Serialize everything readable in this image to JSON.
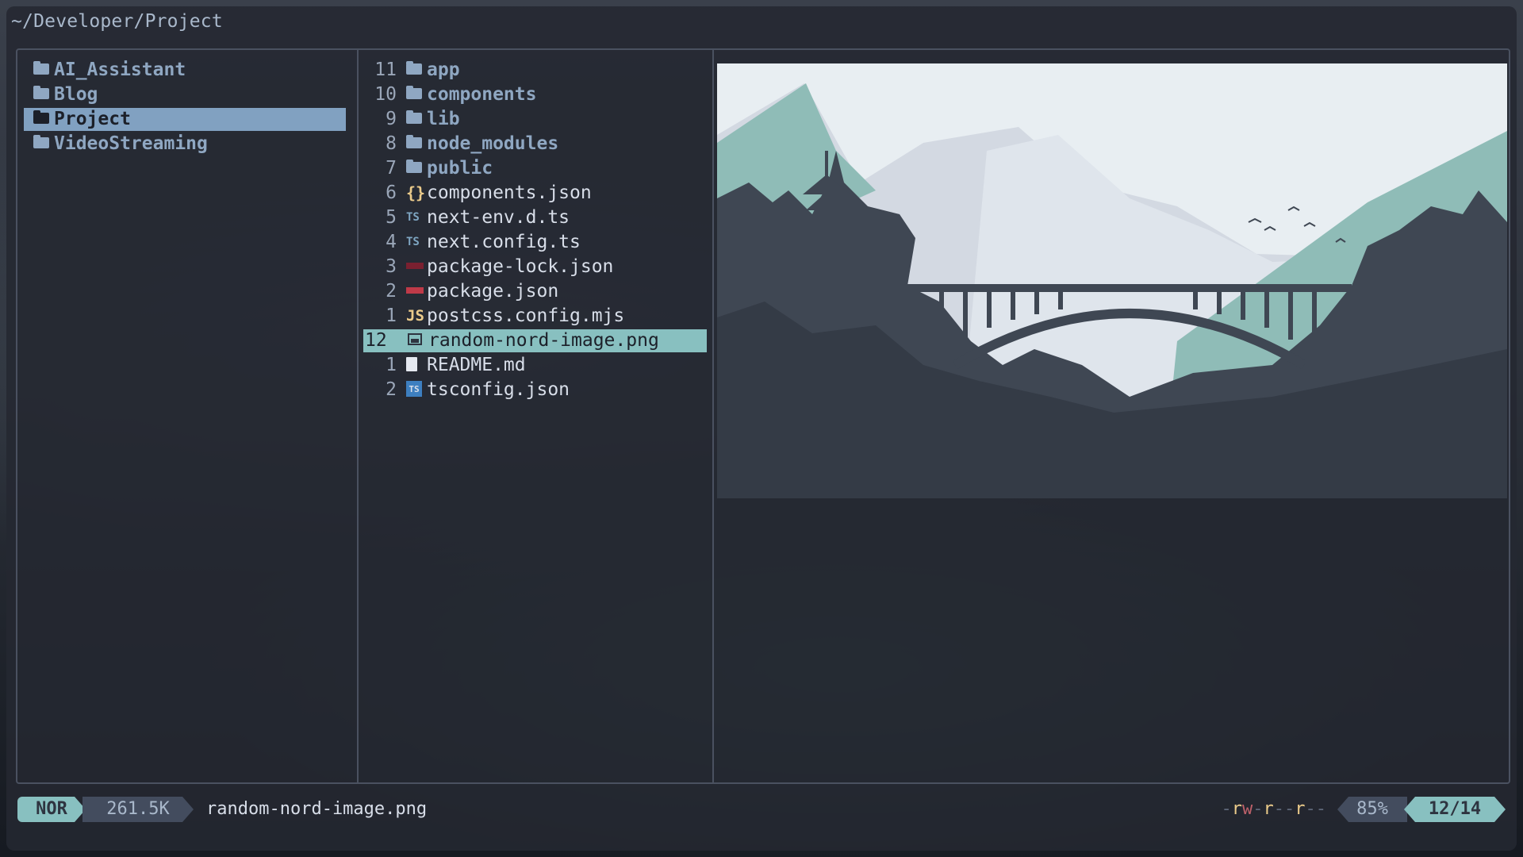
{
  "window": {
    "title": "~/Developer/Project"
  },
  "parent_pane": {
    "items": [
      {
        "label": "AI_Assistant",
        "selected": false
      },
      {
        "label": "Blog",
        "selected": false
      },
      {
        "label": "Project",
        "selected": true
      },
      {
        "label": "VideoStreaming",
        "selected": false
      }
    ]
  },
  "current_pane": {
    "items": [
      {
        "num": "11",
        "label": "app",
        "icon": "folder-icon",
        "type": "dir"
      },
      {
        "num": "10",
        "label": "components",
        "icon": "folder-icon",
        "type": "dir"
      },
      {
        "num": "9",
        "label": "lib",
        "icon": "folder-icon",
        "type": "dir"
      },
      {
        "num": "8",
        "label": "node_modules",
        "icon": "folder-icon",
        "type": "dir"
      },
      {
        "num": "7",
        "label": "public",
        "icon": "folder-icon",
        "type": "dir"
      },
      {
        "num": "6",
        "label": "components.json",
        "icon": "json-icon",
        "type": "file"
      },
      {
        "num": "5",
        "label": "next-env.d.ts",
        "icon": "typescript-icon",
        "type": "file"
      },
      {
        "num": "4",
        "label": "next.config.ts",
        "icon": "typescript-icon",
        "type": "file"
      },
      {
        "num": "3",
        "label": "package-lock.json",
        "icon": "npm-lock-icon",
        "type": "file"
      },
      {
        "num": "2",
        "label": "package.json",
        "icon": "npm-icon",
        "type": "file"
      },
      {
        "num": "1",
        "label": "postcss.config.mjs",
        "icon": "javascript-icon",
        "type": "file"
      },
      {
        "num": "12",
        "label": "random-nord-image.png",
        "icon": "image-icon",
        "type": "file",
        "selected": true
      },
      {
        "num": "1",
        "label": "README.md",
        "icon": "markdown-icon",
        "type": "file"
      },
      {
        "num": "2",
        "label": "tsconfig.json",
        "icon": "tsconfig-icon",
        "type": "file"
      }
    ]
  },
  "preview": {
    "icon": "landscape-image-preview"
  },
  "statusbar": {
    "mode": "NOR",
    "size": "261.5K",
    "filename": "random-nord-image.png",
    "permissions": "-rw-r--r--",
    "percent": "85%",
    "position": "12/14"
  },
  "colors": {
    "accent": "#88c0c0",
    "parent_selection": "#81a1c1",
    "directory": "#8fa7c2",
    "permission_read": "#ebcb8b",
    "permission_write": "#bf616a"
  }
}
